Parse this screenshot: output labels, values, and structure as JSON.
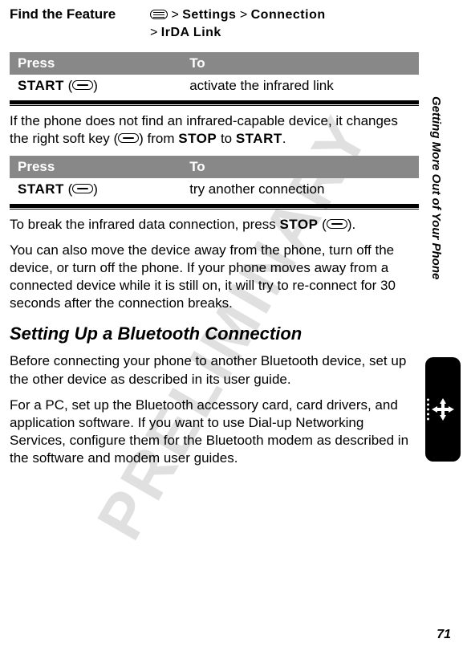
{
  "findFeature": {
    "label": "Find the Feature",
    "pathParts": {
      "sep": ">",
      "settings": "Settings",
      "connection": "Connection",
      "irda": "IrDA Link"
    }
  },
  "table1": {
    "headers": {
      "press": "Press",
      "to": "To"
    },
    "row": {
      "key": "START",
      "action": "activate the infrared link"
    }
  },
  "para1_a": "If the phone does not find an infrared-capable device, it changes the right soft key (",
  "para1_b": ") from ",
  "para1_stop": "STOP",
  "para1_c": " to ",
  "para1_start": "START",
  "para1_d": ".",
  "table2": {
    "headers": {
      "press": "Press",
      "to": "To"
    },
    "row": {
      "key": "START",
      "action": "try another connection"
    }
  },
  "para2_a": "To break the infrared data connection, press ",
  "para2_stop": "STOP",
  "para2_b": " (",
  "para2_c": ").",
  "para3": "You can also move the device away from the phone, turn off the device, or turn off the phone. If your phone moves away from a connected device while it is still on, it will try to re-connect for 30 seconds after the connection breaks.",
  "sectionHeading": "Setting Up a Bluetooth Connection",
  "para4": "Before connecting your phone to another Bluetooth device, set up the other device as described in its user guide.",
  "para5": "For a PC, set up the Bluetooth accessory card, card drivers, and application software. If you want to use Dial-up Networking Services, configure them for the Bluetooth modem as described in the software and modem user guides.",
  "sideLabel": "Getting More Out of Your Phone",
  "pageNumber": "71",
  "watermark": "PRELIMINARY"
}
